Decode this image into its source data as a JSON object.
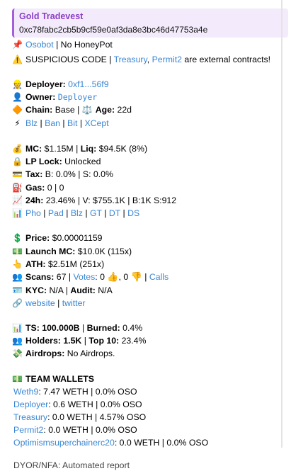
{
  "token_name": "Gold Tradevest",
  "contract": "0xc78fabc2cb5b9cf59e0af3da8e3bc46d47753a4e",
  "bot_link": "Osobot",
  "honeypot": " | No HoneyPot",
  "suspicious": "SUSPICIOUS CODE | ",
  "ext_a": "Treasury",
  "ext_b": "Permit2",
  "ext_tail": " are external contracts!",
  "deployer_label": "Deployer:",
  "deployer_value": "0xf1...56f9",
  "owner_label": "Owner:",
  "owner_value": "Deployer",
  "chain_label": "Chain:",
  "chain_value": "Base",
  "age_label": "Age:",
  "age_value": "22d",
  "scan_links": [
    "Blz",
    "Ban",
    "Bit",
    "XCept"
  ],
  "mc_label": "MC:",
  "mc_value": "$1.15M",
  "liq_label": "Liq:",
  "liq_value": "$94.5K (8%)",
  "lplock_label": "LP Lock:",
  "lplock_value": "Unlocked",
  "tax_label": "Tax:",
  "tax_value": "B: 0.0% | S: 0.0%",
  "gas_label": "Gas:",
  "gas_value": "0 | 0",
  "h24_label": "24h:",
  "h24_value": "23.46% | V: $755.1K | B:1K S:912",
  "chart_links": [
    "Pho",
    "Pad",
    "Blz",
    "GT",
    "DT",
    "DS"
  ],
  "price_label": "Price:",
  "price_value": "$0.00001159",
  "launch_label": "Launch MC:",
  "launch_value": "$10.0K (115x)",
  "ath_label": "ATH:",
  "ath_value": "$2.51M (251x)",
  "scans_label": "Scans:",
  "scans_value": "67 | ",
  "votes_link": "Votes",
  "votes_up": ": 0 ",
  "votes_down": ", 0 ",
  "calls_link": "Calls",
  "kyc_label": "KYC:",
  "kyc_value": "N/A | ",
  "audit_label": "Audit:",
  "audit_value": "N/A",
  "website_link": "website",
  "twitter_link": "twitter",
  "ts_label": "TS:",
  "ts_value": "100.000B",
  "burned_label": "Burned:",
  "burned_value": "0.4%",
  "holders_label": "Holders:",
  "holders_value": "1.5K",
  "top10_label": "Top 10:",
  "top10_value": "23.4%",
  "airdrops_label": "Airdrops:",
  "airdrops_value": "No Airdrops.",
  "team_title": "TEAM WALLETS",
  "wallets": [
    {
      "name": "Weth9",
      "value": ": 7.47 WETH | 0.0% OSO"
    },
    {
      "name": "Deployer",
      "value": ": 0.6 WETH | 0.0% OSO"
    },
    {
      "name": "Treasury",
      "value": ": 0.0 WETH | 4.57% OSO"
    },
    {
      "name": "Permit2",
      "value": ": 0.0 WETH | 0.0% OSO"
    },
    {
      "name": "Optimismsuperchainerc20",
      "value": ": 0.0 WETH | 0.0% OSO"
    }
  ],
  "footer": "DYOR/NFA: Automated report"
}
